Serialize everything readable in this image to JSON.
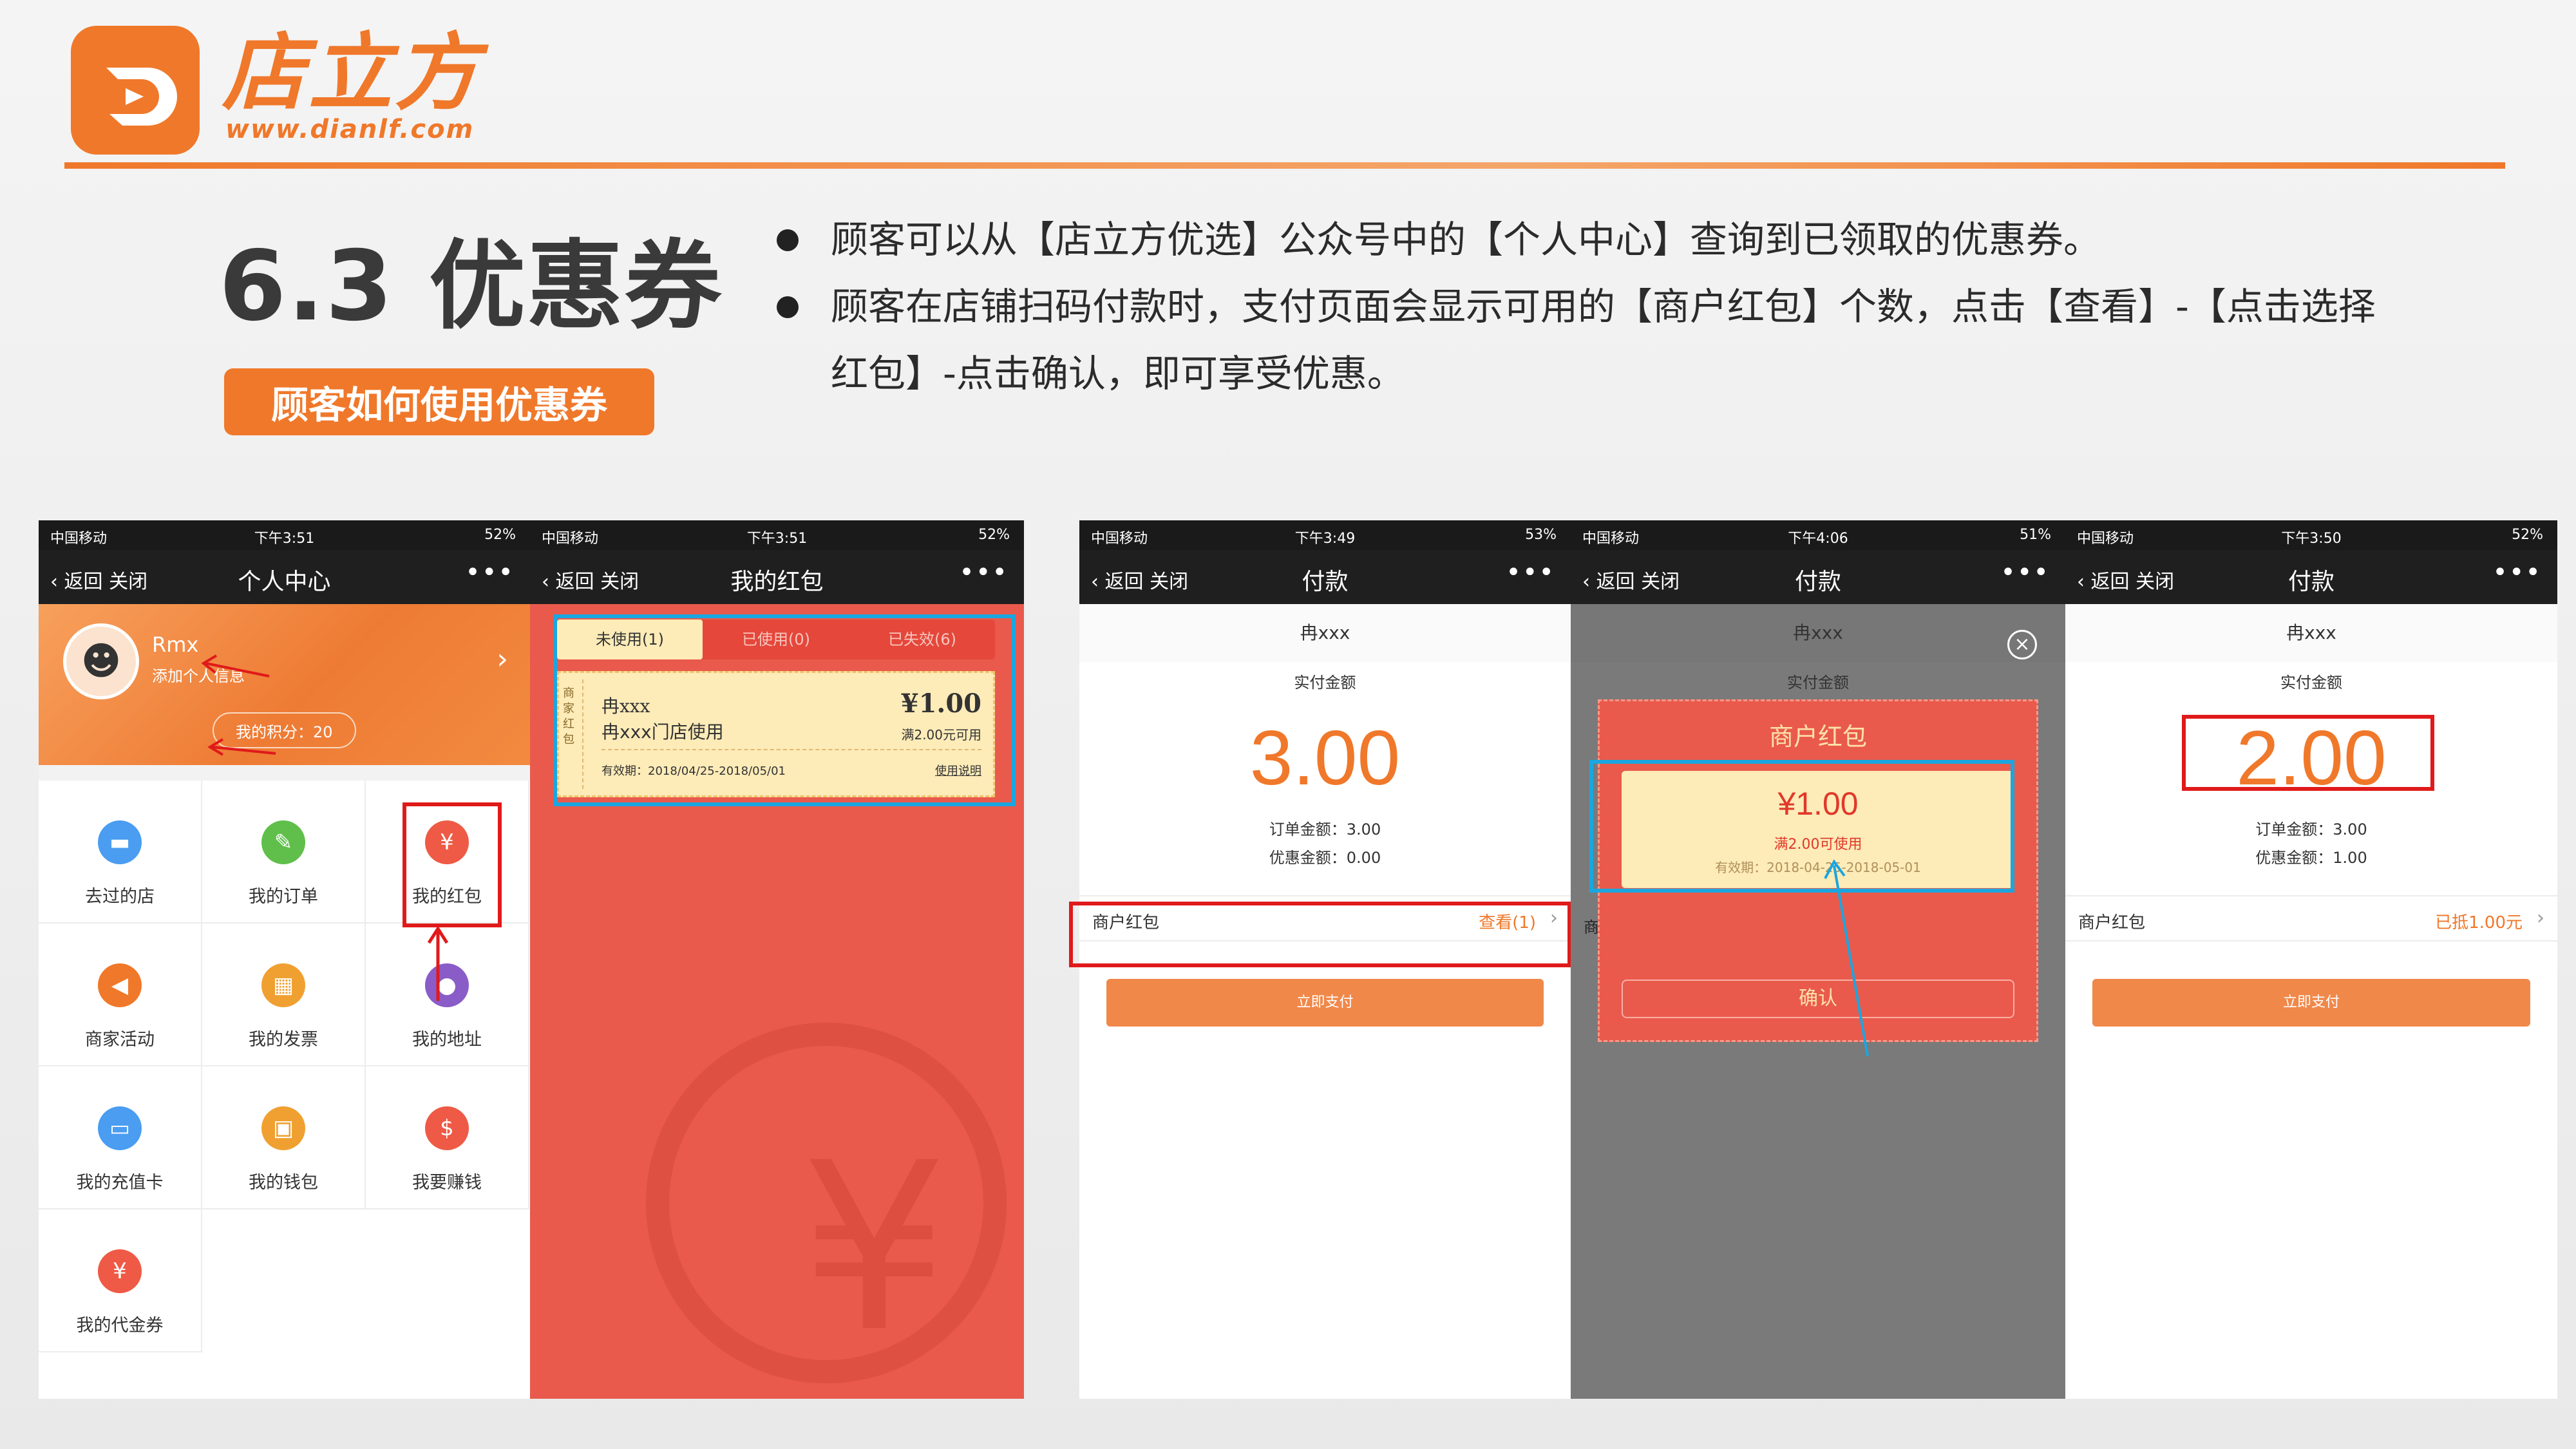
{
  "brand": {
    "name": "店立方",
    "url": "www.dianlf.com",
    "accent_color": "#f0782a"
  },
  "section": {
    "title": "6.3 优惠券",
    "badge": "顾客如何使用优惠券"
  },
  "bullets": [
    "顾客可以从【店立方优选】公众号中的【个人中心】查询到已领取的优惠券。",
    "顾客在店铺扫码付款时，支付页面会显示可用的【商户红包】个数，点击【查看】-【点击选择",
    "红包】-点击确认，即可享受优惠。"
  ],
  "phones": {
    "p1": {
      "status": {
        "carrier": "中国移动",
        "time": "下午3:51",
        "battery": "52%"
      },
      "nav": {
        "back": "返回  关闭",
        "title": "个人中心",
        "more": "•••"
      },
      "profile": {
        "username": "Rmx",
        "add_info": "添加个人信息",
        "points": "我的积分：20"
      },
      "grid": [
        {
          "label": "去过的店",
          "icon": "shop-icon",
          "color": "#4a9df0",
          "glyph": "▬"
        },
        {
          "label": "我的订单",
          "icon": "order-icon",
          "color": "#5fbf4a",
          "glyph": "✎"
        },
        {
          "label": "我的红包",
          "icon": "red-packet-icon",
          "color": "#ee5a45",
          "glyph": "¥"
        },
        {
          "label": "商家活动",
          "icon": "promo-icon",
          "color": "#f0782a",
          "glyph": "◀"
        },
        {
          "label": "我的发票",
          "icon": "invoice-icon",
          "color": "#f0a030",
          "glyph": "▦"
        },
        {
          "label": "我的地址",
          "icon": "location-icon",
          "color": "#8a5cc8",
          "glyph": "●"
        },
        {
          "label": "我的充值卡",
          "icon": "card-icon",
          "color": "#4a9df0",
          "glyph": "▭"
        },
        {
          "label": "我的钱包",
          "icon": "wallet-icon",
          "color": "#f0a030",
          "glyph": "▣"
        },
        {
          "label": "我要赚钱",
          "icon": "earn-icon",
          "color": "#ee5a45",
          "glyph": "$"
        },
        {
          "label": "我的代金券",
          "icon": "voucher-icon",
          "color": "#ee5a45",
          "glyph": "¥"
        }
      ]
    },
    "p2": {
      "status": {
        "carrier": "中国移动",
        "time": "下午3:51",
        "battery": "52%"
      },
      "nav": {
        "back": "返回  关闭",
        "title": "我的红包",
        "more": "•••"
      },
      "tabs": [
        "未使用(1)",
        "已使用(0)",
        "已失效(6)"
      ],
      "coupon": {
        "side": "商家红包",
        "shop": "冉xxx",
        "scope": "冉xxx门店使用",
        "amount": "¥1.00",
        "condition": "满2.00元可用",
        "validity": "有效期：2018/04/25-2018/05/01",
        "rules": "使用说明"
      }
    },
    "p3": {
      "status": {
        "carrier": "中国移动",
        "time": "下午3:49",
        "battery": "53%"
      },
      "nav": {
        "back": "返回  关闭",
        "title": "付款",
        "more": "•••"
      },
      "shop": "冉xxx",
      "paid_label": "实付金额",
      "amount": "3.00",
      "order_total": "订单金额：3.00",
      "discount": "优惠金额：0.00",
      "row_label": "商户红包",
      "row_action": "查看(1)",
      "pay_button": "立即支付"
    },
    "p4": {
      "status": {
        "carrier": "中国移动",
        "time": "下午4:06",
        "battery": "51%"
      },
      "nav": {
        "back": "返回  关闭",
        "title": "付款",
        "more": "•••"
      },
      "shop": "冉xxx",
      "paid_label": "实付金额",
      "popup_title": "商户红包",
      "popup_amount": "¥1.00",
      "popup_condition": "满2.00可使用",
      "popup_validity": "有效期：2018-04-25-2018-05-01",
      "confirm": "确认",
      "row_fragment": "商"
    },
    "p5": {
      "status": {
        "carrier": "中国移动",
        "time": "下午3:50",
        "battery": "52%"
      },
      "nav": {
        "back": "返回  关闭",
        "title": "付款",
        "more": "•••"
      },
      "shop": "冉xxx",
      "paid_label": "实付金额",
      "amount": "2.00",
      "order_total": "订单金额：3.00",
      "discount": "优惠金额：1.00",
      "row_label": "商户红包",
      "row_action": "已抵1.00元",
      "pay_button": "立即支付"
    }
  }
}
